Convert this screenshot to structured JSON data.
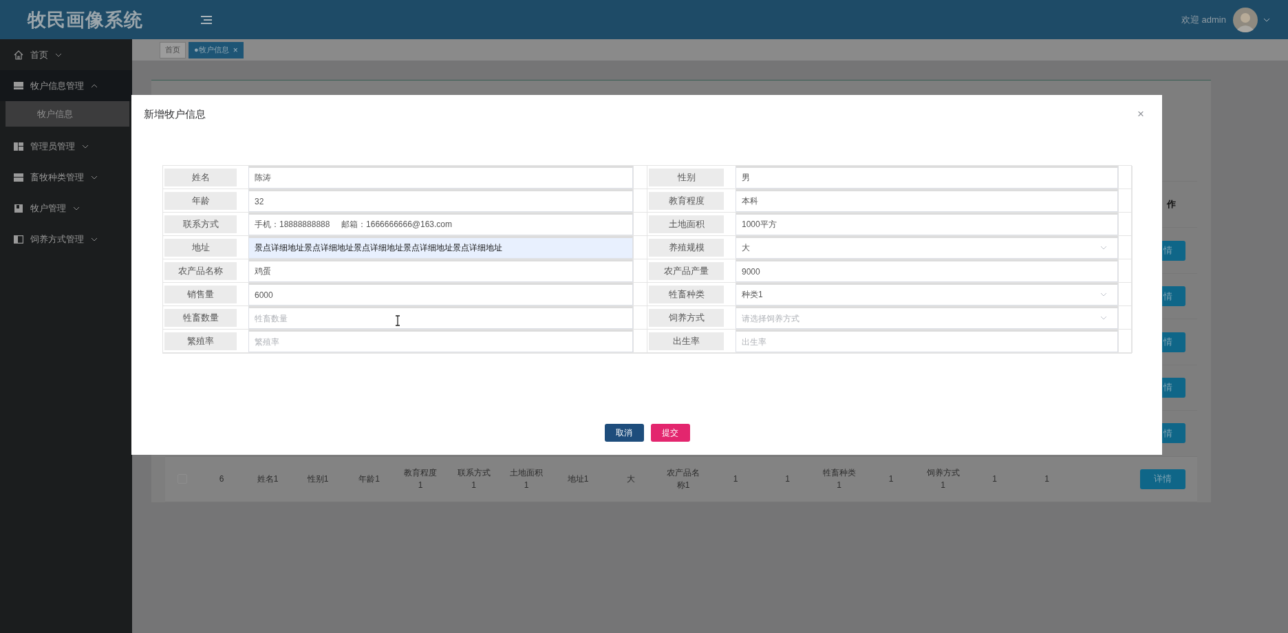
{
  "header": {
    "logo": "牧民画像系统",
    "welcome": "欢迎 admin"
  },
  "sidebar": {
    "items": [
      {
        "label": "首页",
        "expanded": false,
        "selected": false
      },
      {
        "label": "牧户信息管理",
        "expanded": true,
        "selected": false,
        "children": [
          {
            "label": "牧户信息",
            "selected": true
          }
        ]
      },
      {
        "label": "管理员管理",
        "expanded": false,
        "selected": false
      },
      {
        "label": "畜牧种类管理",
        "expanded": false,
        "selected": false
      },
      {
        "label": "牧户管理",
        "expanded": false,
        "selected": false
      },
      {
        "label": "饲养方式管理",
        "expanded": false,
        "selected": false
      }
    ]
  },
  "tabs": [
    {
      "label": "首页",
      "selected": false
    },
    {
      "label": "●牧户信息",
      "selected": true,
      "close": "×"
    }
  ],
  "table": {
    "column_header": "作",
    "partial_buttons": [
      "情",
      "情",
      "情",
      "情",
      "情"
    ],
    "rows": [
      {
        "checked": false,
        "cells": [
          "6",
          "姓名1",
          "性别1",
          "年龄1",
          "教育程度1",
          "联系方式1",
          "土地面积1",
          "地址1",
          "大",
          "农产品名称1",
          "1",
          "1",
          "牲畜种类1",
          "1",
          "饲养方式1",
          "1",
          "1"
        ],
        "action": "详情"
      }
    ]
  },
  "dialog": {
    "title": "新增牧户信息",
    "close": "×",
    "fields": [
      {
        "label": "姓名",
        "kind": "text",
        "value": "陈涛",
        "autofilled": false
      },
      {
        "label": "性别",
        "kind": "text",
        "value": "男",
        "autofilled": false
      },
      {
        "label": "年龄",
        "kind": "text",
        "value": "32",
        "autofilled": false
      },
      {
        "label": "教育程度",
        "kind": "text",
        "value": "本科",
        "autofilled": false
      },
      {
        "label": "联系方式",
        "kind": "text",
        "value": "手机：18888888888     邮箱：1666666666@163.com",
        "autofilled": false
      },
      {
        "label": "土地面积",
        "kind": "text",
        "value": "1000平方",
        "autofilled": false
      },
      {
        "label": "地址",
        "kind": "text",
        "value": "景点详细地址景点详细地址景点详细地址景点详细地址景点详细地址",
        "autofilled": true
      },
      {
        "label": "养殖规模",
        "kind": "select",
        "value": "大",
        "autofilled": false
      },
      {
        "label": "农产品名称",
        "kind": "text",
        "value": "鸡蛋",
        "autofilled": false
      },
      {
        "label": "农产品产量",
        "kind": "text",
        "value": "9000",
        "autofilled": false
      },
      {
        "label": "销售量",
        "kind": "text",
        "value": "6000",
        "autofilled": false
      },
      {
        "label": "牲畜种类",
        "kind": "select",
        "value": "种类1",
        "autofilled": false
      },
      {
        "label": "牲畜数量",
        "kind": "text",
        "placeholder": "牲畜数量",
        "autofilled": false
      },
      {
        "label": "饲养方式",
        "kind": "select",
        "placeholder": "请选择饲养方式",
        "autofilled": false
      },
      {
        "label": "繁殖率",
        "kind": "text",
        "placeholder": "繁殖率",
        "autofilled": false
      },
      {
        "label": "出生率",
        "kind": "text",
        "placeholder": "出生率",
        "autofilled": false
      }
    ],
    "buttons": [
      {
        "label": "取消",
        "kind": "cancel"
      },
      {
        "label": "提交",
        "kind": "submit"
      }
    ]
  }
}
